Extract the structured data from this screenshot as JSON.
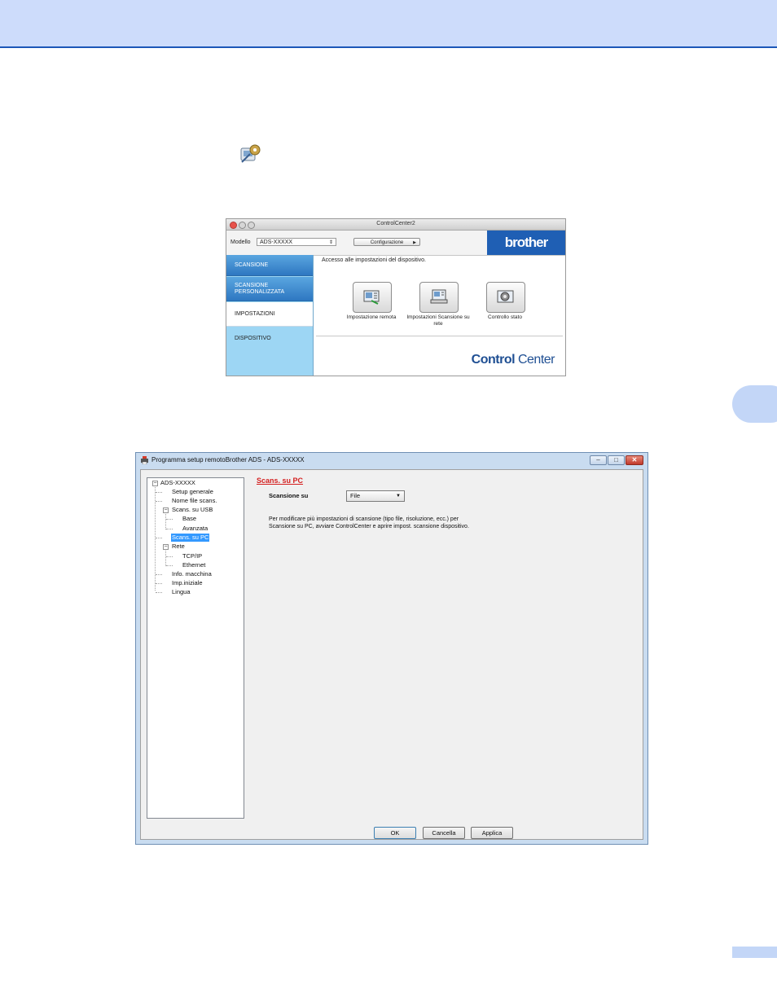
{
  "colors": {
    "header_band": "#cddcfb",
    "accent_blue": "#1c57b8",
    "red_heading": "#d42020",
    "cc_sidebar": "#9dd6f4"
  },
  "step_icon": "device-settings-icon",
  "controlcenter": {
    "title": "ControlCenter2",
    "model_label": "Modello",
    "model_value": "ADS-XXXXX",
    "config_button": "Configurazione",
    "logo": "brother",
    "sidebar": [
      {
        "label": "SCANSIONE"
      },
      {
        "label": "SCANSIONE PERSONALIZZATA"
      },
      {
        "label": "IMPOSTAZIONI DISPOSITIVO",
        "selected": true
      }
    ],
    "heading": "Accesso alle impostazioni del dispositivo.",
    "buttons": [
      {
        "icon": "remote-setup-icon",
        "label": "Impostazione remota"
      },
      {
        "icon": "network-scan-settings-icon",
        "label": "Impostazioni Scansione su rete"
      },
      {
        "icon": "status-monitor-icon",
        "label": "Controllo stato"
      }
    ],
    "brand_bold": "Control",
    "brand_regular": " Center"
  },
  "remote_setup": {
    "title": "Programma setup remotoBrother ADS - ADS-XXXXX",
    "window_controls": [
      "–",
      "□",
      "✕"
    ],
    "tree": {
      "root": "ADS-XXXXX",
      "setup_generale": "Setup generale",
      "nome_file": "Nome file scans.",
      "scans_usb": "Scans. su USB",
      "base": "Base",
      "avanzata": "Avanzata",
      "scans_pc": "Scans. su PC",
      "rete": "Rete",
      "tcpip": "TCP/IP",
      "ethernet": "Ethernet",
      "info": "Info. macchina",
      "imp_iniziale": "Imp.iniziale",
      "lingua": "Lingua"
    },
    "heading": "Scans. su PC",
    "field_label": "Scansione su",
    "field_value": "File",
    "desc_line1": "Per modificare più impostazioni di scansione (tipo file, risoluzione, ecc.) per",
    "desc_line2": "Scansione su PC, avviare ControlCenter e aprire impost. scansione dispositivo.",
    "buttons": {
      "ok": "OK",
      "cancel": "Cancella",
      "apply": "Applica"
    }
  }
}
